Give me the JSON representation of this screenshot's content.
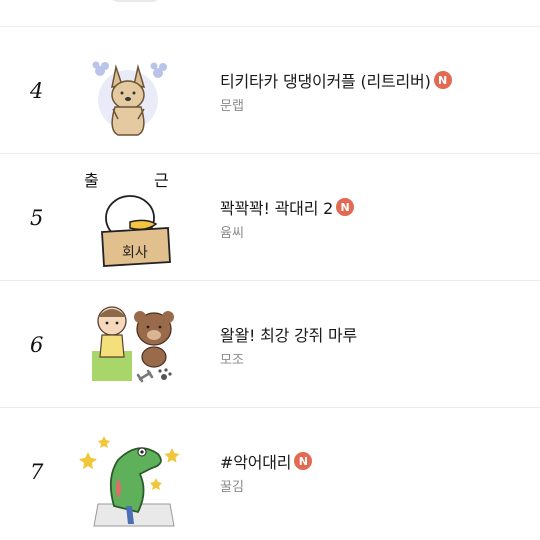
{
  "items": [
    {
      "rank": "4",
      "title": "티키타카 댕댕이커플 (리트리버)",
      "badge": "N",
      "author": "문랩",
      "thumb_icon": "retriever-dog-sticker-icon"
    },
    {
      "rank": "5",
      "title": "꽉꽉꽉! 곽대리 2",
      "badge": "N",
      "author": "윰씨",
      "thumb_icon": "duck-in-box-sticker-icon",
      "thumb_text": {
        "top_left": "출",
        "top_right": "근",
        "box": "회사"
      }
    },
    {
      "rank": "6",
      "title": "왈왈! 최강 강쥐 마루",
      "badge": "",
      "author": "모조",
      "thumb_icon": "maru-dog-and-girl-sticker-icon"
    },
    {
      "rank": "7",
      "title": "#악어대리",
      "badge": "N",
      "author": "꿀김",
      "thumb_icon": "crocodile-sticker-icon"
    }
  ],
  "colors": {
    "badge": "#e26a52",
    "author": "#8a8a8a",
    "divider": "#ececec"
  }
}
